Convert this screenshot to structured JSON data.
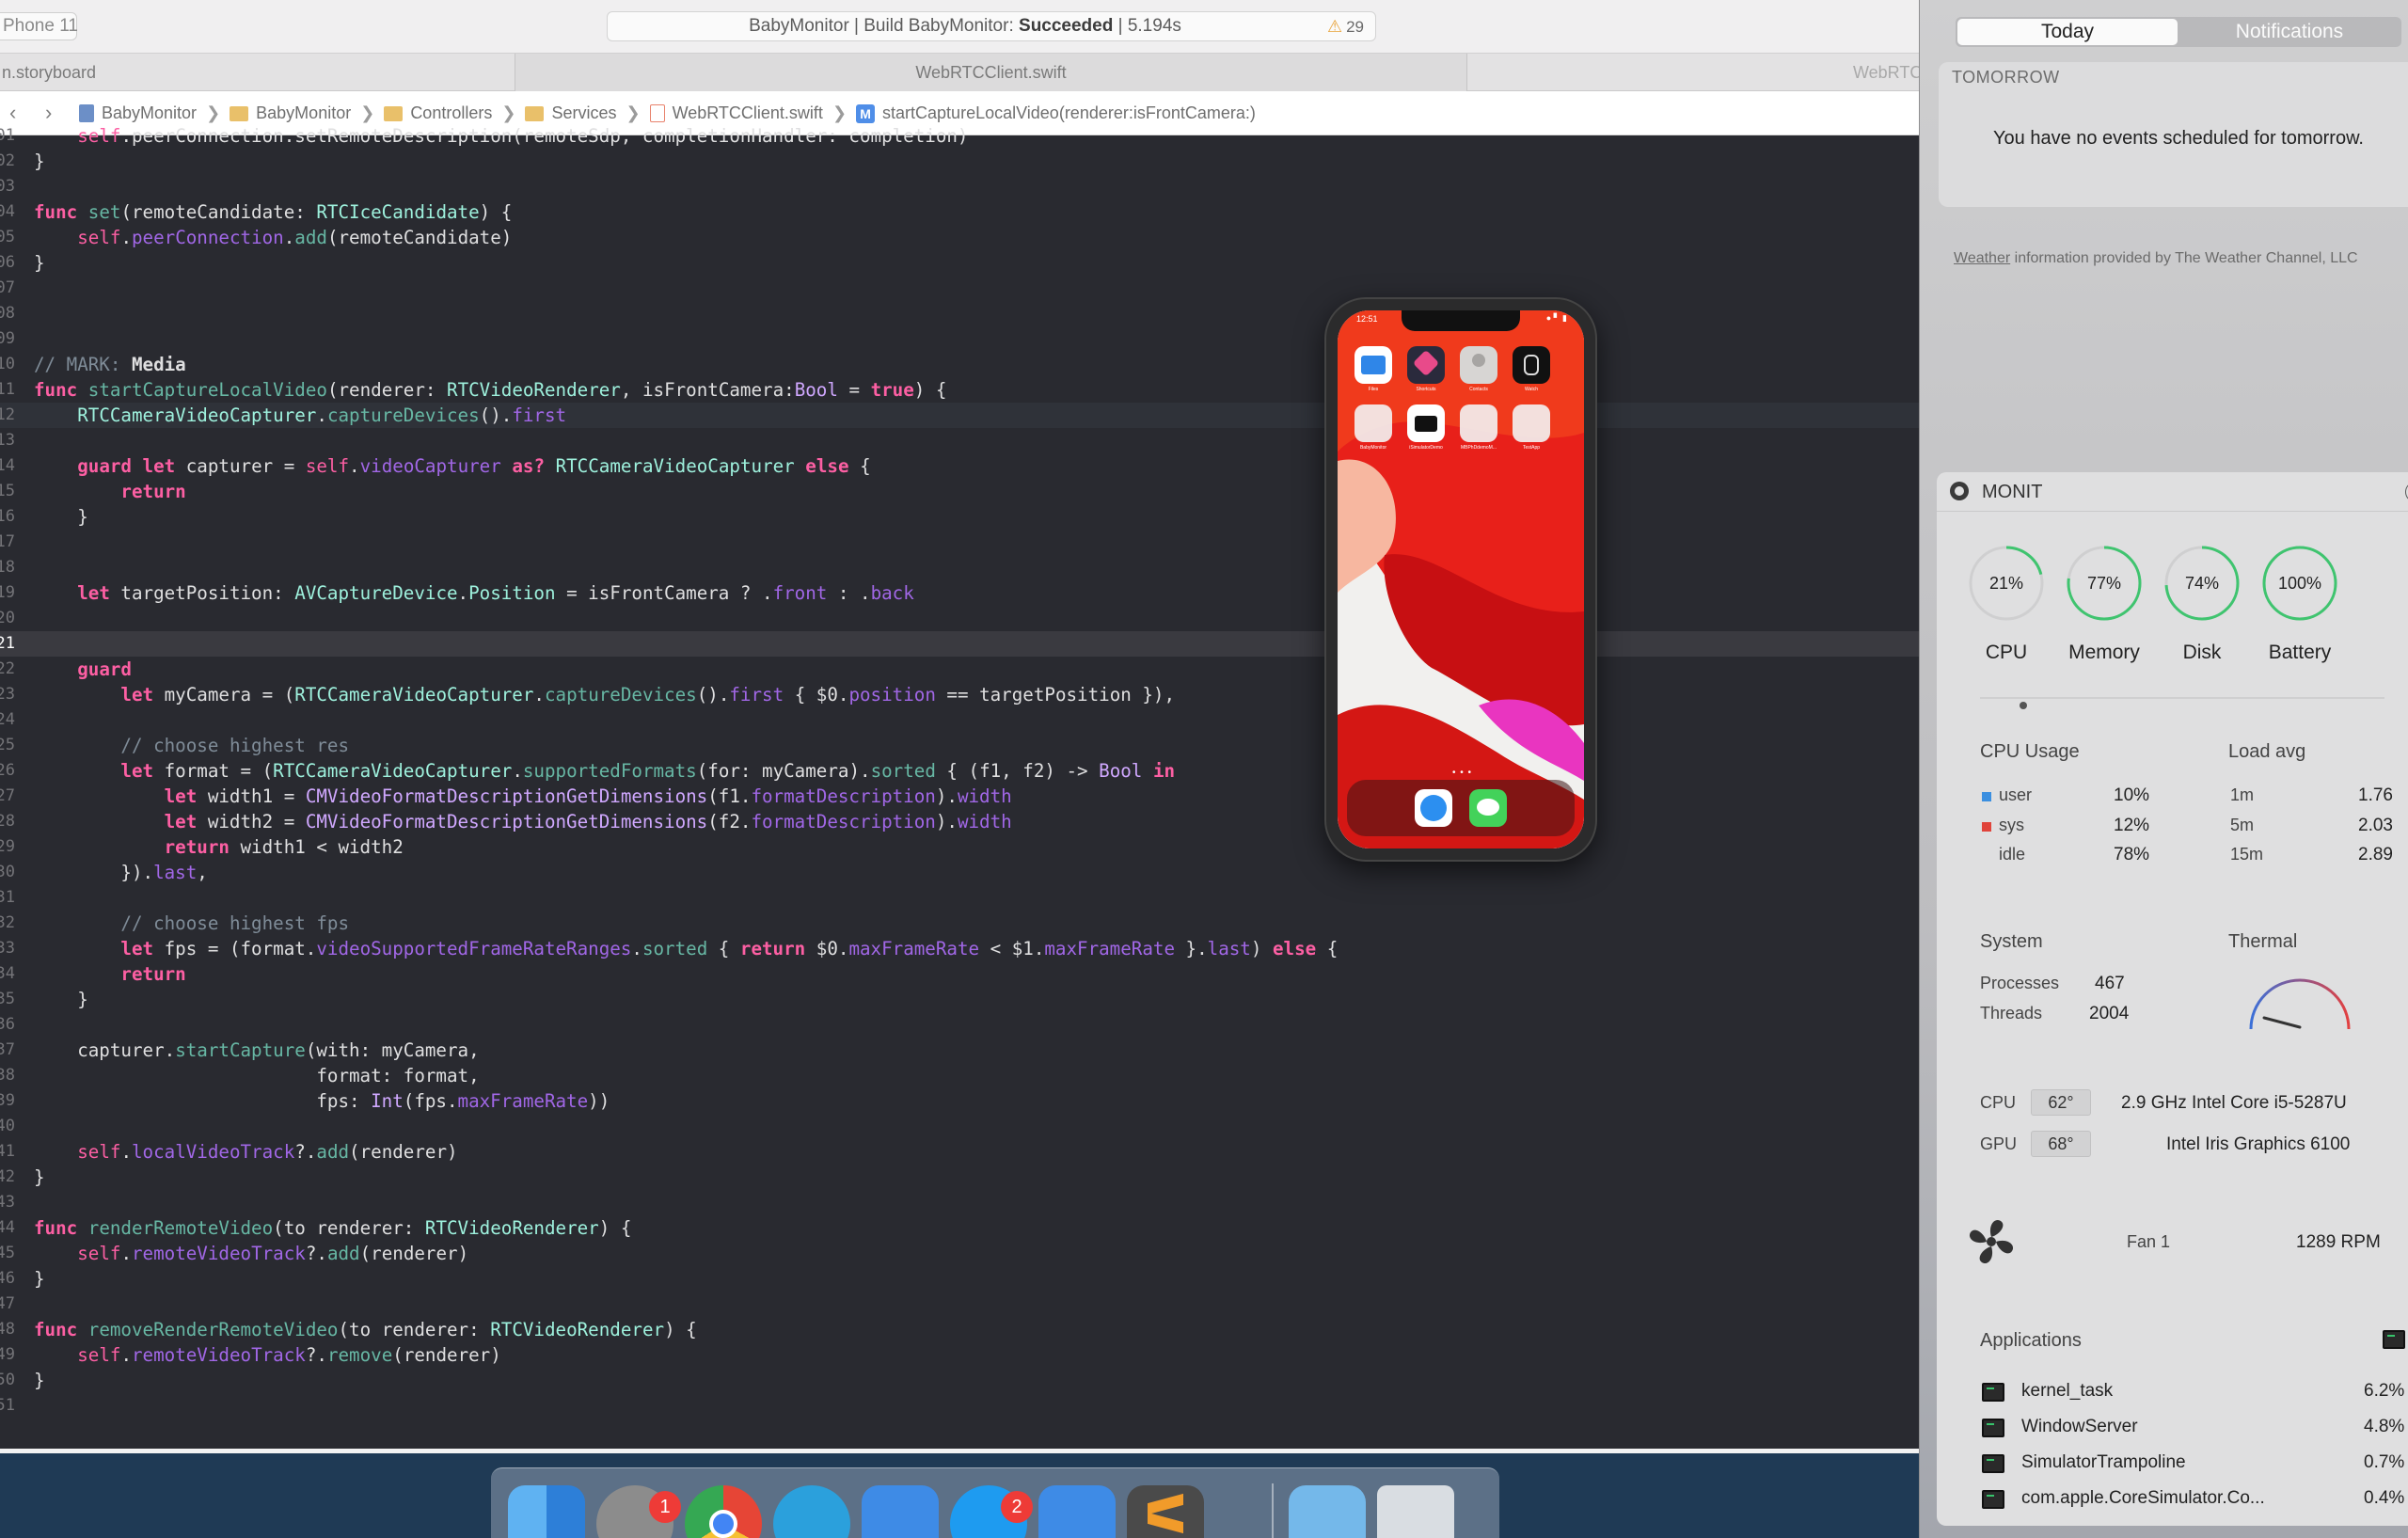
{
  "xcode": {
    "scheme": "Phone 11",
    "activity": {
      "prefix": "BabyMonitor | Build BabyMonitor: ",
      "status": "Succeeded",
      "suffix": " | 5.194s",
      "warnings": "29"
    },
    "tabs": [
      "n.storyboard",
      "WebRTCClient.swift",
      "WebRTC"
    ],
    "breadcrumb": [
      "BabyMonitor",
      "BabyMonitor",
      "Controllers",
      "Services",
      "WebRTCClient.swift",
      "startCaptureLocalVideo(renderer:isFrontCamera:)"
    ],
    "line_numbers": [
      "01",
      "02",
      "03",
      "04",
      "05",
      "06",
      "07",
      "08",
      "09",
      "10",
      "11",
      "12",
      "13",
      "14",
      "15",
      "16",
      "17",
      "18",
      "19",
      "20",
      "21",
      "22",
      "23",
      "24",
      "25",
      "26",
      "27",
      "28",
      "29",
      "30",
      "31",
      "32",
      "33",
      "34",
      "35",
      "36",
      "37",
      "38",
      "39",
      "40",
      "41",
      "42",
      "43",
      "44",
      "45",
      "46",
      "47",
      "48",
      "49",
      "50",
      "51"
    ]
  },
  "simulator": {
    "time": "12:51",
    "status_icons": "● ▘ ▮",
    "apps_row1": [
      "Files",
      "Shortcuts",
      "Contacts",
      "Watch"
    ],
    "apps_row2": [
      "BabyMonitor",
      "iSimulatorDemo",
      "MBPhDdemoM...",
      "TestApp"
    ]
  },
  "notification_center": {
    "tab_today": "Today",
    "tab_notifications": "Notifications",
    "tomorrow_heading": "TOMORROW",
    "no_events": "You have no events scheduled for tomorrow.",
    "weather_link": "Weather",
    "weather_note": " information provided by The Weather Channel, LLC"
  },
  "monit": {
    "title": "MONIT",
    "gauges": [
      {
        "label": "CPU",
        "value": "21%",
        "fraction": 0.21,
        "color": "#3fc46f"
      },
      {
        "label": "Memory",
        "value": "77%",
        "fraction": 0.77,
        "color": "#3fc46f"
      },
      {
        "label": "Disk",
        "value": "74%",
        "fraction": 0.74,
        "color": "#3fc46f"
      },
      {
        "label": "Battery",
        "value": "100%",
        "fraction": 1.0,
        "color": "#3fc46f"
      }
    ],
    "cpu_usage_title": "CPU Usage",
    "load_avg_title": "Load avg",
    "cpu_rows": [
      {
        "name": "user",
        "value": "10%",
        "color": "#3b8fe0"
      },
      {
        "name": "sys",
        "value": "12%",
        "color": "#e0443b"
      },
      {
        "name": "idle",
        "value": "78%",
        "color": ""
      }
    ],
    "load_rows": [
      {
        "period": "1m",
        "value": "1.76"
      },
      {
        "period": "5m",
        "value": "2.03"
      },
      {
        "period": "15m",
        "value": "2.89"
      }
    ],
    "system_title": "System",
    "thermal_title": "Thermal",
    "processes_label": "Processes",
    "processes_value": "467",
    "threads_label": "Threads",
    "threads_value": "2004",
    "cpu_temp_label": "CPU",
    "cpu_temp": "62°",
    "cpu_name": "2.9 GHz Intel Core i5-5287U",
    "gpu_temp_label": "GPU",
    "gpu_temp": "68°",
    "gpu_name": "Intel Iris Graphics 6100",
    "fan_label": "Fan 1",
    "fan_rpm": "1289 RPM",
    "applications_title": "Applications",
    "apps": [
      {
        "name": "kernel_task",
        "value": "6.2%"
      },
      {
        "name": "WindowServer",
        "value": "4.8%"
      },
      {
        "name": "SimulatorTrampoline",
        "value": "0.7%"
      },
      {
        "name": "com.apple.CoreSimulator.Co...",
        "value": "0.4%"
      }
    ]
  },
  "dock": {
    "badges": {
      "system_preferences": "1",
      "app_store": "2"
    }
  }
}
